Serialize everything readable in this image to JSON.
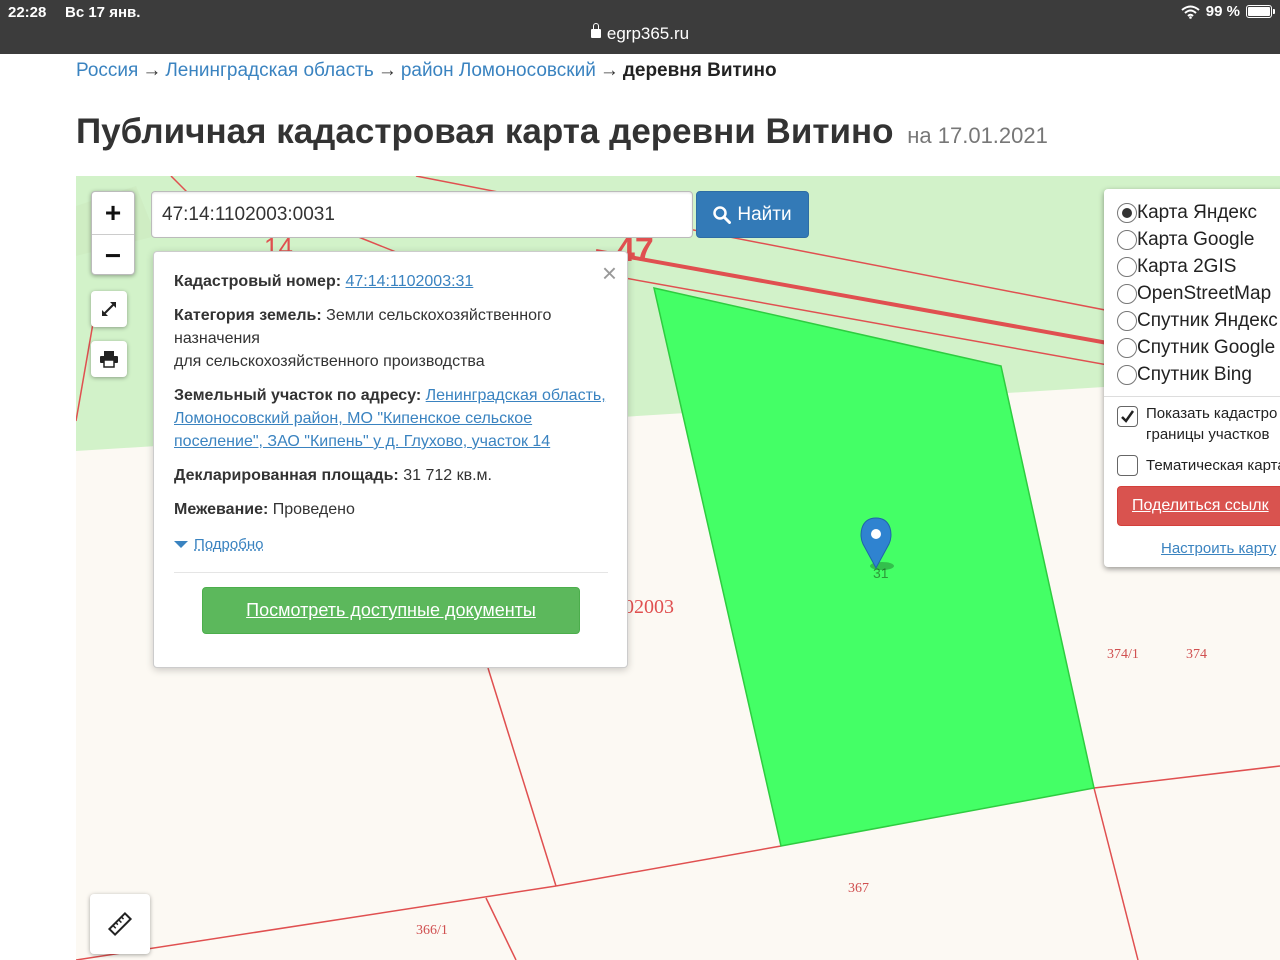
{
  "status_bar": {
    "time": "22:28",
    "date": "Вс 17 янв.",
    "url": "egrp365.ru",
    "battery": "99 %",
    "icons": [
      "lock-icon",
      "wifi-icon",
      "battery-icon"
    ]
  },
  "breadcrumb": {
    "items": [
      "Россия",
      "Ленинградская область",
      "район Ломоносовский"
    ],
    "current": "деревня Витино",
    "separator": "→"
  },
  "page": {
    "title": "Публичная кадастровая карта деревни Витино",
    "date": "на 17.01.2021"
  },
  "map": {
    "search_value": "47:14:1102003:0031",
    "find_button": "Найти",
    "zoom_in": "+",
    "zoom_out": "−",
    "labels": {
      "quarter_top": "14",
      "region": "47",
      "quarter_mid": "02003",
      "parcel_31": "31",
      "parcel_374_1": "374/1",
      "parcel_374": "374",
      "parcel_367": "367",
      "parcel_366_1": "366/1"
    },
    "highlight_color": "#44ff66",
    "boundary_color": "#e05050",
    "marker_color": "#2f83d0"
  },
  "popup": {
    "cadastral_label": "Кадастровый номер:",
    "cadastral_value": "47:14:1102003:31",
    "category_label": "Категория земель:",
    "category_value_1": "Земли сельскохозяйственного назначения",
    "category_value_2": "для сельскохозяйственного производства",
    "address_label": "Земельный участок по адресу:",
    "address_value": "Ленинградская область, Ломоносовский район, МО \"Кипенское сельское поселение\", ЗАО \"Кипень\" у д. Глухово, участок 14",
    "area_label": "Декларированная площадь:",
    "area_value": "31 712 кв.м.",
    "survey_label": "Межевание:",
    "survey_value": "Проведено",
    "more_link": "Подробно",
    "docs_button": "Посмотреть доступные документы",
    "close": "×"
  },
  "layers": {
    "options": [
      "Карта Яндекс",
      "Карта Google",
      "Карта 2GIS",
      "OpenStreetMap",
      "Спутник Яндекс",
      "Спутник Google",
      "Спутник Bing"
    ],
    "selected_index": 0,
    "show_borders_1": "Показать кадастро",
    "show_borders_2": "границы участков",
    "show_borders_checked": true,
    "thematic": "Тематическая карта",
    "thematic_checked": false,
    "share_button": "Поделиться ссылк",
    "configure_link": "Настроить карту"
  }
}
